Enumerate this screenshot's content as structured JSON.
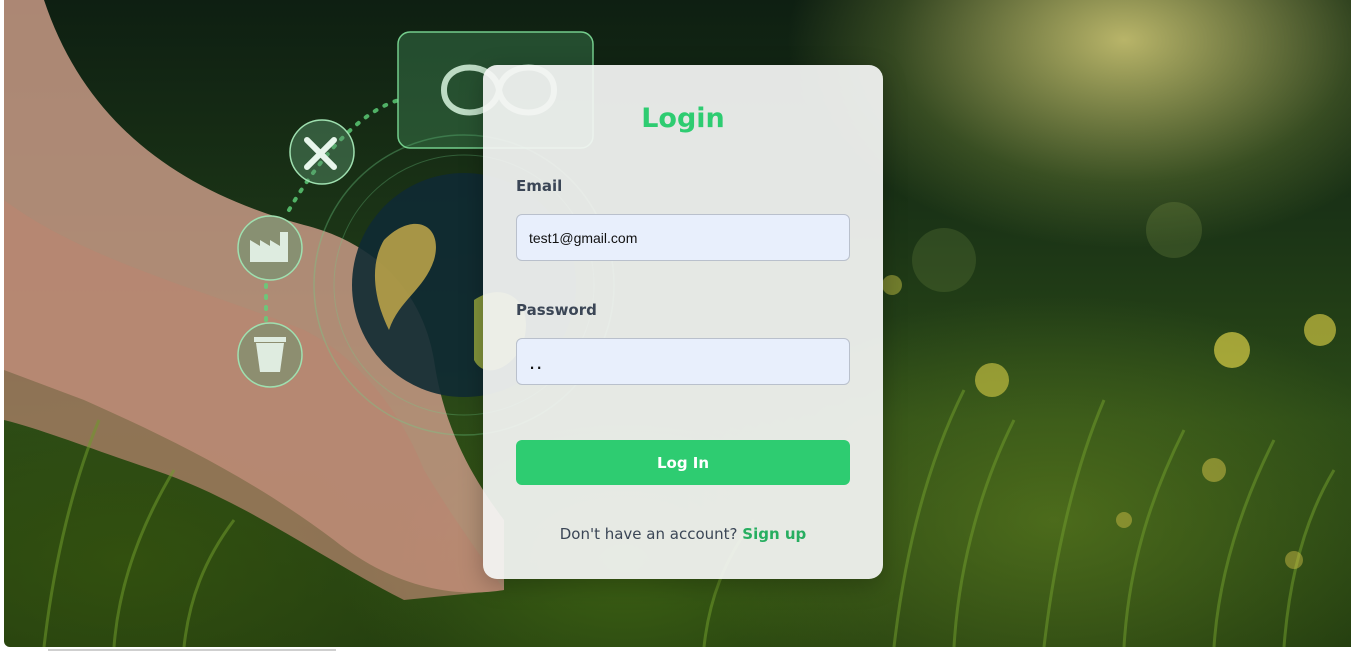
{
  "login": {
    "title": "Login",
    "email_label": "Email",
    "email_value": "test1@gmail.com",
    "password_label": "Password",
    "password_value": "..",
    "submit_label": "Log In",
    "signup_prompt": "Don't have an account?",
    "signup_link": "Sign up"
  },
  "icons": [
    "infinity-icon",
    "tools-icon",
    "factory-icon",
    "recycle-bin-icon",
    "globe-icon"
  ],
  "colors": {
    "accent": "#2ecc71",
    "link": "#27ae60",
    "input_background": "#e8effc",
    "label_text": "#3b4656"
  }
}
